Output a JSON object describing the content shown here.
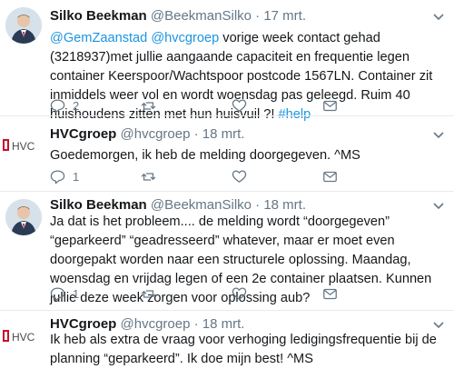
{
  "tweets": [
    {
      "author": "Silko Beekman",
      "handle": "@BeekmanSilko",
      "date": "· 17 mrt.",
      "mention1": "@GemZaanstad",
      "mention2": "@hvcgroep",
      "text_rest": " vorige week contact gehad (3218937)met jullie aangaande capaciteit en frequentie legen container Keerspoor/Wachtspoor postcode 1567LN. Container zit inmiddels weer vol en wordt woensdag pas geleegd. Ruim 40 huishoudens zitten met hun huisvuil ?! ",
      "hashtag": "#help",
      "reply_count": "2",
      "avatar_icon": "person-photo"
    },
    {
      "author": "HVCgroep",
      "handle": "@hvcgroep",
      "date": "· 18 mrt.",
      "text": "Goedemorgen, ik heb de melding doorgegeven. ^MS",
      "reply_count": "1",
      "logo_text": "HVC",
      "avatar_icon": "hvc-logo"
    },
    {
      "author": "Silko Beekman",
      "handle": "@BeekmanSilko",
      "date": "· 18 mrt.",
      "text": "Ja dat is het probleem.... de melding wordt “doorgegeven” “geparkeerd” “geadresseerd” whatever, maar er moet even doorgepakt worden naar een structurele oplossing. Maandag, woensdag en vrijdag legen of een 2e container plaatsen. Kunnen jullie deze week zorgen voor oplossing aub?",
      "reply_count": "1",
      "avatar_icon": "person-photo"
    },
    {
      "author": "HVCgroep",
      "handle": "@hvcgroep",
      "date": "· 18 mrt.",
      "text": "Ik heb als extra de vraag voor verhoging ledigingsfrequentie bij de planning “geparkeerd”. Ik doe mijn best! ^MS",
      "logo_text": "HVC",
      "avatar_icon": "hvc-logo"
    }
  ],
  "colors": {
    "link": "#1b95e0",
    "muted": "#657786",
    "divider": "#e6ecf0",
    "logo_red": "#c8102e"
  }
}
